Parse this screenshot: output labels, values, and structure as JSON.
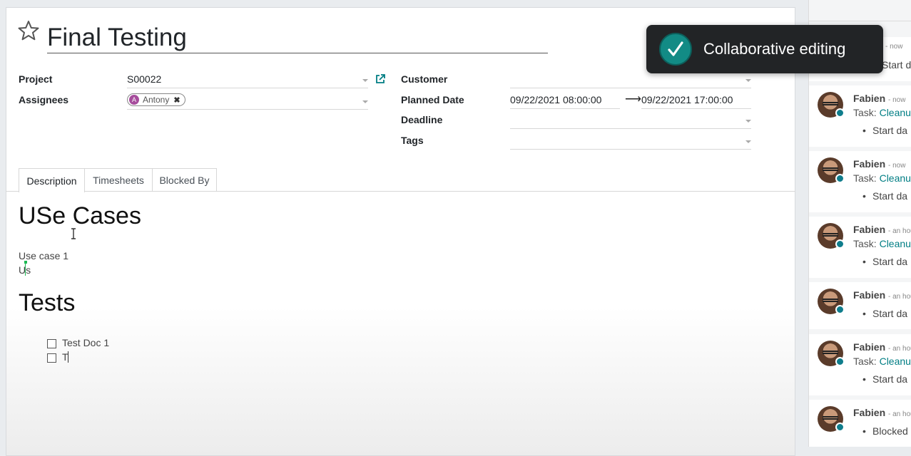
{
  "form": {
    "title": "Final Testing",
    "project_label": "Project",
    "project_value": "S00022",
    "assignees_label": "Assignees",
    "assignee_initial": "A",
    "assignee_name": "Antony",
    "customer_label": "Customer",
    "planned_date_label": "Planned Date",
    "planned_start": "09/22/2021 08:00:00",
    "planned_end": "09/22/2021 17:00:00",
    "deadline_label": "Deadline",
    "tags_label": "Tags"
  },
  "tabs": [
    {
      "label": "Description",
      "active": true
    },
    {
      "label": "Timesheets",
      "active": false
    },
    {
      "label": "Blocked By",
      "active": false
    }
  ],
  "description": {
    "heading1": "USe Cases",
    "line1": "Use case 1",
    "line2": "Us",
    "heading2": "Tests",
    "check_items": [
      "Test Doc 1",
      "T"
    ]
  },
  "toast": {
    "text": "Collaborative editing",
    "icon": "check-icon",
    "color": "#128b85"
  },
  "chatter": {
    "top_message": {
      "time": "- now",
      "line": "Start da"
    },
    "messages": [
      {
        "author": "Fabien",
        "time": "- now",
        "task_prefix": "Task:",
        "task_link": "Cleanup",
        "bullet": "Start da"
      },
      {
        "author": "Fabien",
        "time": "- now",
        "task_prefix": "Task:",
        "task_link": "Cleanup",
        "bullet": "Start da"
      },
      {
        "author": "Fabien",
        "time": "- an hou",
        "task_prefix": "Task:",
        "task_link": "Cleanup",
        "bullet": "Start da"
      },
      {
        "author": "Fabien",
        "time": "- an hou",
        "task_prefix": "",
        "task_link": "",
        "bullet": "Start da"
      },
      {
        "author": "Fabien",
        "time": "- an hou",
        "task_prefix": "Task:",
        "task_link": "Cleanup",
        "bullet": "Start da"
      },
      {
        "author": "Fabien",
        "time": "- an hou",
        "task_prefix": "",
        "task_link": "",
        "bullet": "Blocked"
      }
    ]
  },
  "colors": {
    "accent": "#017e84",
    "online": "#0f7d8c",
    "assignee_avatar": "#a64d9c"
  }
}
